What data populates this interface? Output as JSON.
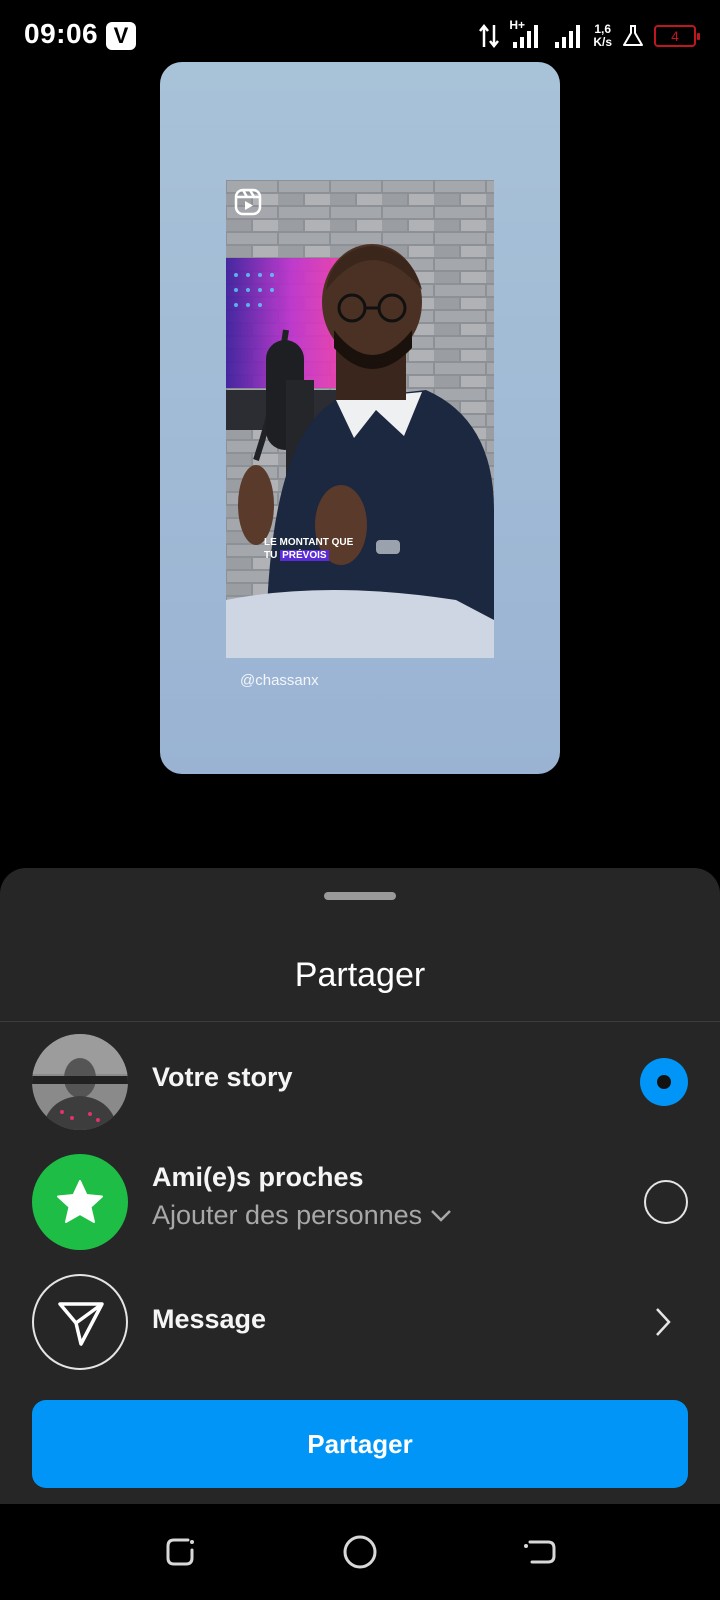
{
  "status_bar": {
    "time": "09:06",
    "app_badge": "V",
    "network_type": "H+",
    "speed_value": "1,6",
    "speed_unit": "K/s",
    "battery_level": "4"
  },
  "story_preview": {
    "reel_caption_line1": "LE MONTANT QUE",
    "reel_caption_line2_pre": "TU ",
    "reel_caption_line2_hl": "PRÉVOIS",
    "handle": "@chassanx"
  },
  "share_sheet": {
    "title": "Partager",
    "options": [
      {
        "label": "Votre story",
        "selected": true
      },
      {
        "label": "Ami(e)s proches",
        "sublabel": "Ajouter des personnes",
        "selected": false
      },
      {
        "label": "Message"
      }
    ],
    "share_button_label": "Partager"
  },
  "colors": {
    "accent": "#0095f6",
    "sheet_bg": "#262626",
    "close_friends_green": "#1ebd46",
    "battery_low": "#c0161d"
  }
}
